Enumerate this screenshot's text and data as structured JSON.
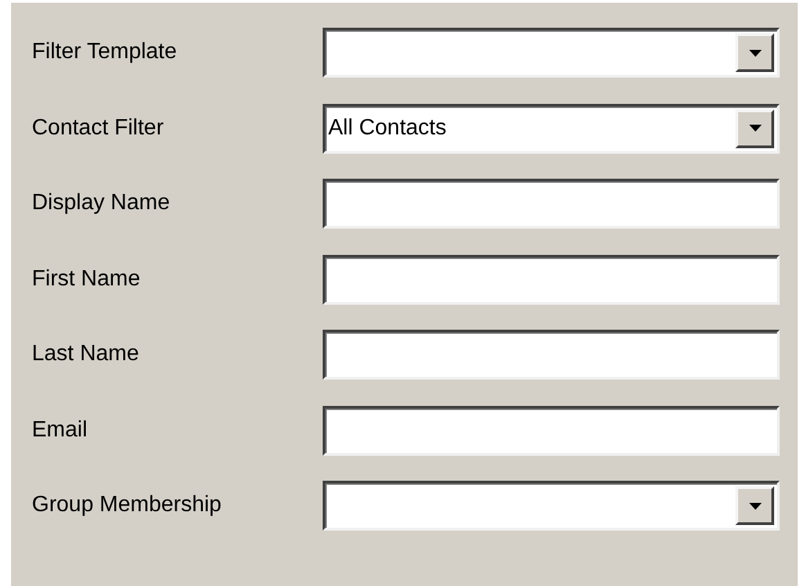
{
  "fields": [
    {
      "label": "Filter Template",
      "kind": "combo"
    },
    {
      "label": "Contact Filter",
      "kind": "combo",
      "value": "All Contacts"
    },
    {
      "label": "Display Name",
      "kind": "text"
    },
    {
      "label": "First Name",
      "kind": "text"
    },
    {
      "label": "Last Name",
      "kind": "text"
    },
    {
      "label": "Email",
      "kind": "text"
    },
    {
      "label": "Group Membership",
      "kind": "combo"
    }
  ]
}
